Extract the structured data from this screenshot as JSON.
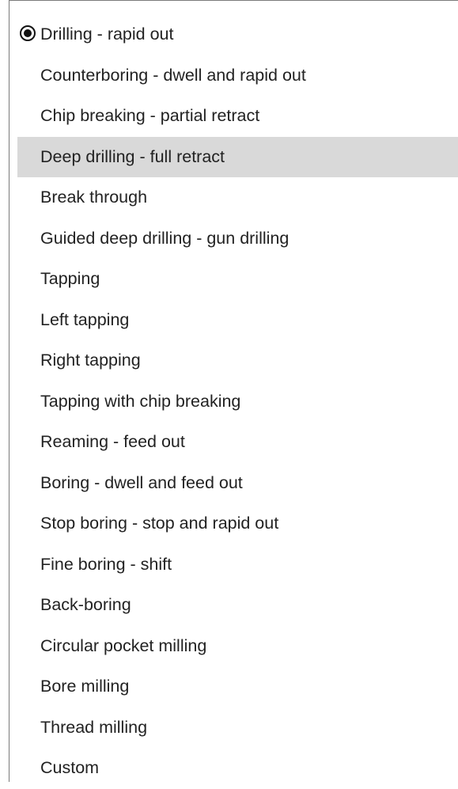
{
  "menu": {
    "selected_index": 0,
    "highlighted_index": 3,
    "items": [
      {
        "label": "Drilling - rapid out"
      },
      {
        "label": "Counterboring - dwell and rapid out"
      },
      {
        "label": "Chip breaking - partial retract"
      },
      {
        "label": "Deep drilling - full retract"
      },
      {
        "label": "Break through"
      },
      {
        "label": "Guided deep drilling - gun drilling"
      },
      {
        "label": "Tapping"
      },
      {
        "label": "Left tapping"
      },
      {
        "label": "Right tapping"
      },
      {
        "label": "Tapping with chip breaking"
      },
      {
        "label": "Reaming - feed out"
      },
      {
        "label": "Boring - dwell and feed out"
      },
      {
        "label": "Stop boring - stop and rapid out"
      },
      {
        "label": "Fine boring - shift"
      },
      {
        "label": "Back-boring"
      },
      {
        "label": "Circular pocket milling"
      },
      {
        "label": "Bore milling"
      },
      {
        "label": "Thread milling"
      },
      {
        "label": "Custom"
      }
    ]
  },
  "colors": {
    "highlight": "#d9d9d9",
    "text": "#222222",
    "border": "#7a7a7a"
  },
  "icons": {
    "selected_marker": "radio-selected-icon"
  }
}
